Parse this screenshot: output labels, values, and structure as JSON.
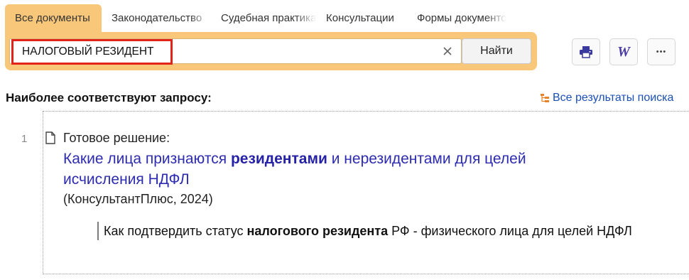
{
  "tabs": [
    {
      "label": "Все документы",
      "active": true
    },
    {
      "label": "Законодательство",
      "active": false
    },
    {
      "label": "Судебная практика",
      "active": false
    },
    {
      "label": "Консультации",
      "active": false
    },
    {
      "label": "Формы документов",
      "active": false
    }
  ],
  "search": {
    "query": "НАЛОГОВЫЙ РЕЗИДЕНТ",
    "clear_icon": "close-icon",
    "find_label": "Найти"
  },
  "toolbar": {
    "print_icon": "printer-icon",
    "word_label": "W",
    "more_label": "•••"
  },
  "results": {
    "heading": "Наиболее соответствуют запросу:",
    "all_results_label": "Все результаты поиска",
    "items": [
      {
        "number": "1",
        "type": "Готовое решение:",
        "title_before": "Какие лица признаются ",
        "title_bold": "резидентами",
        "title_after": " и нерезидентами для целей исчисления НДФЛ",
        "source": "(КонсультантПлюс, 2024)",
        "snippet_before": "Как подтвердить статус ",
        "snippet_bold": "налогового резидента",
        "snippet_after": " РФ - физического лица для целей НДФЛ"
      }
    ]
  },
  "colors": {
    "accent": "#f9c77a",
    "link": "#2d2bb0",
    "highlight_border": "#e2231a"
  }
}
